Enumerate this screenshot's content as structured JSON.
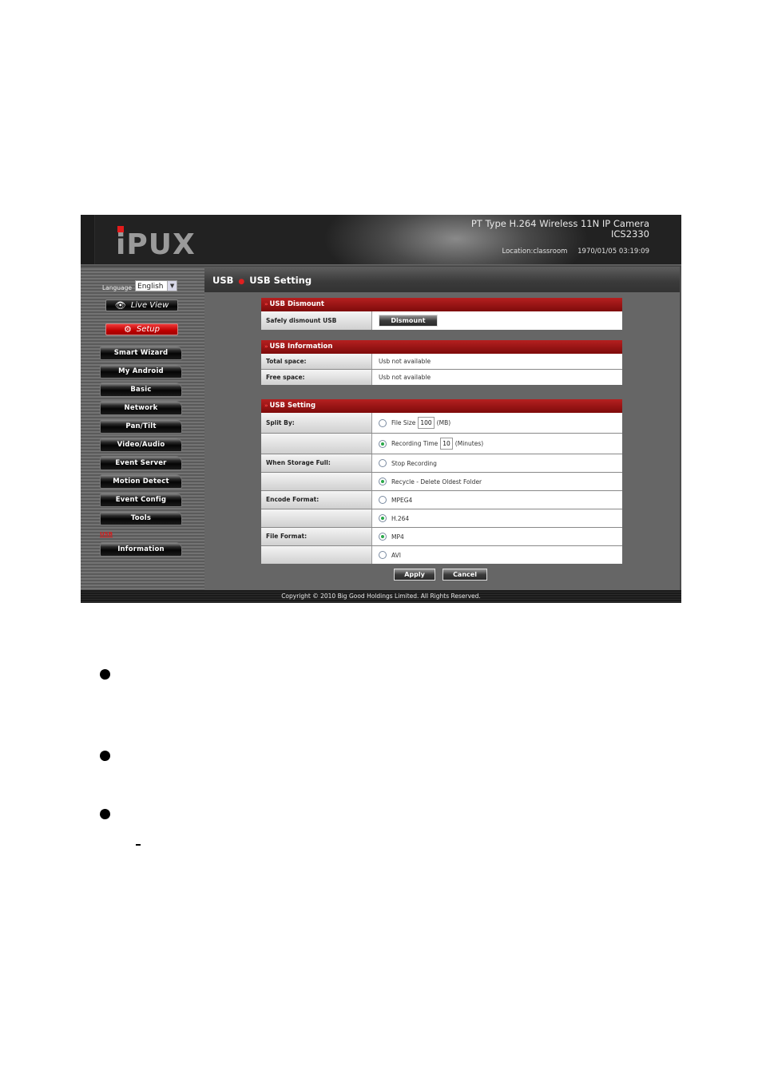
{
  "header": {
    "logo": "iPUX",
    "product_line1": "PT Type H.264 Wireless 11N IP Camera",
    "product_line2": "ICS2330",
    "location": "Location:classroom",
    "datetime": "1970/01/05 03:19:09"
  },
  "sidebar": {
    "language_label": "Language",
    "language_value": "English",
    "live_view": "Live View",
    "setup": "Setup",
    "items": [
      {
        "label": "Smart Wizard"
      },
      {
        "label": "My Android"
      },
      {
        "label": "Basic"
      },
      {
        "label": "Network"
      },
      {
        "label": "Pan/Tilt"
      },
      {
        "label": "Video/Audio"
      },
      {
        "label": "Event Server"
      },
      {
        "label": "Motion Detect"
      },
      {
        "label": "Event Config"
      },
      {
        "label": "Tools"
      },
      {
        "label": "Information"
      }
    ],
    "usb_link": "USB"
  },
  "breadcrumb": {
    "parent": "USB",
    "current": "USB Setting"
  },
  "dismount_section": {
    "title": "USB Dismount",
    "label": "Safely dismount USB",
    "button": "Dismount"
  },
  "info_section": {
    "title": "USB Information",
    "rows": [
      {
        "label": "Total space:",
        "value": "Usb not available"
      },
      {
        "label": "Free space:",
        "value": "Usb not available"
      }
    ]
  },
  "setting_section": {
    "title": "USB Setting",
    "split_by_label": "Split By:",
    "file_size_label": "File Size",
    "file_size_value": "100",
    "file_size_unit": "(MB)",
    "recording_time_label": "Recording Time",
    "recording_time_value": "10",
    "recording_time_unit": "(Minutes)",
    "split_by_selected": "Recording Time",
    "storage_full_label": "When Storage Full:",
    "stop_recording": "Stop Recording",
    "recycle": "Recycle - Delete Oldest Folder",
    "storage_full_selected": "Recycle - Delete Oldest Folder",
    "encode_label": "Encode Format:",
    "encode_mpeg4": "MPEG4",
    "encode_h264": "H.264",
    "encode_selected": "H.264",
    "file_format_label": "File Format:",
    "file_mp4": "MP4",
    "file_avi": "AVI",
    "file_format_selected": "MP4"
  },
  "actions": {
    "apply": "Apply",
    "cancel": "Cancel"
  },
  "footer": {
    "copyright": "Copyright © 2010 Big Good Holdings Limited. All Rights Reserved."
  }
}
